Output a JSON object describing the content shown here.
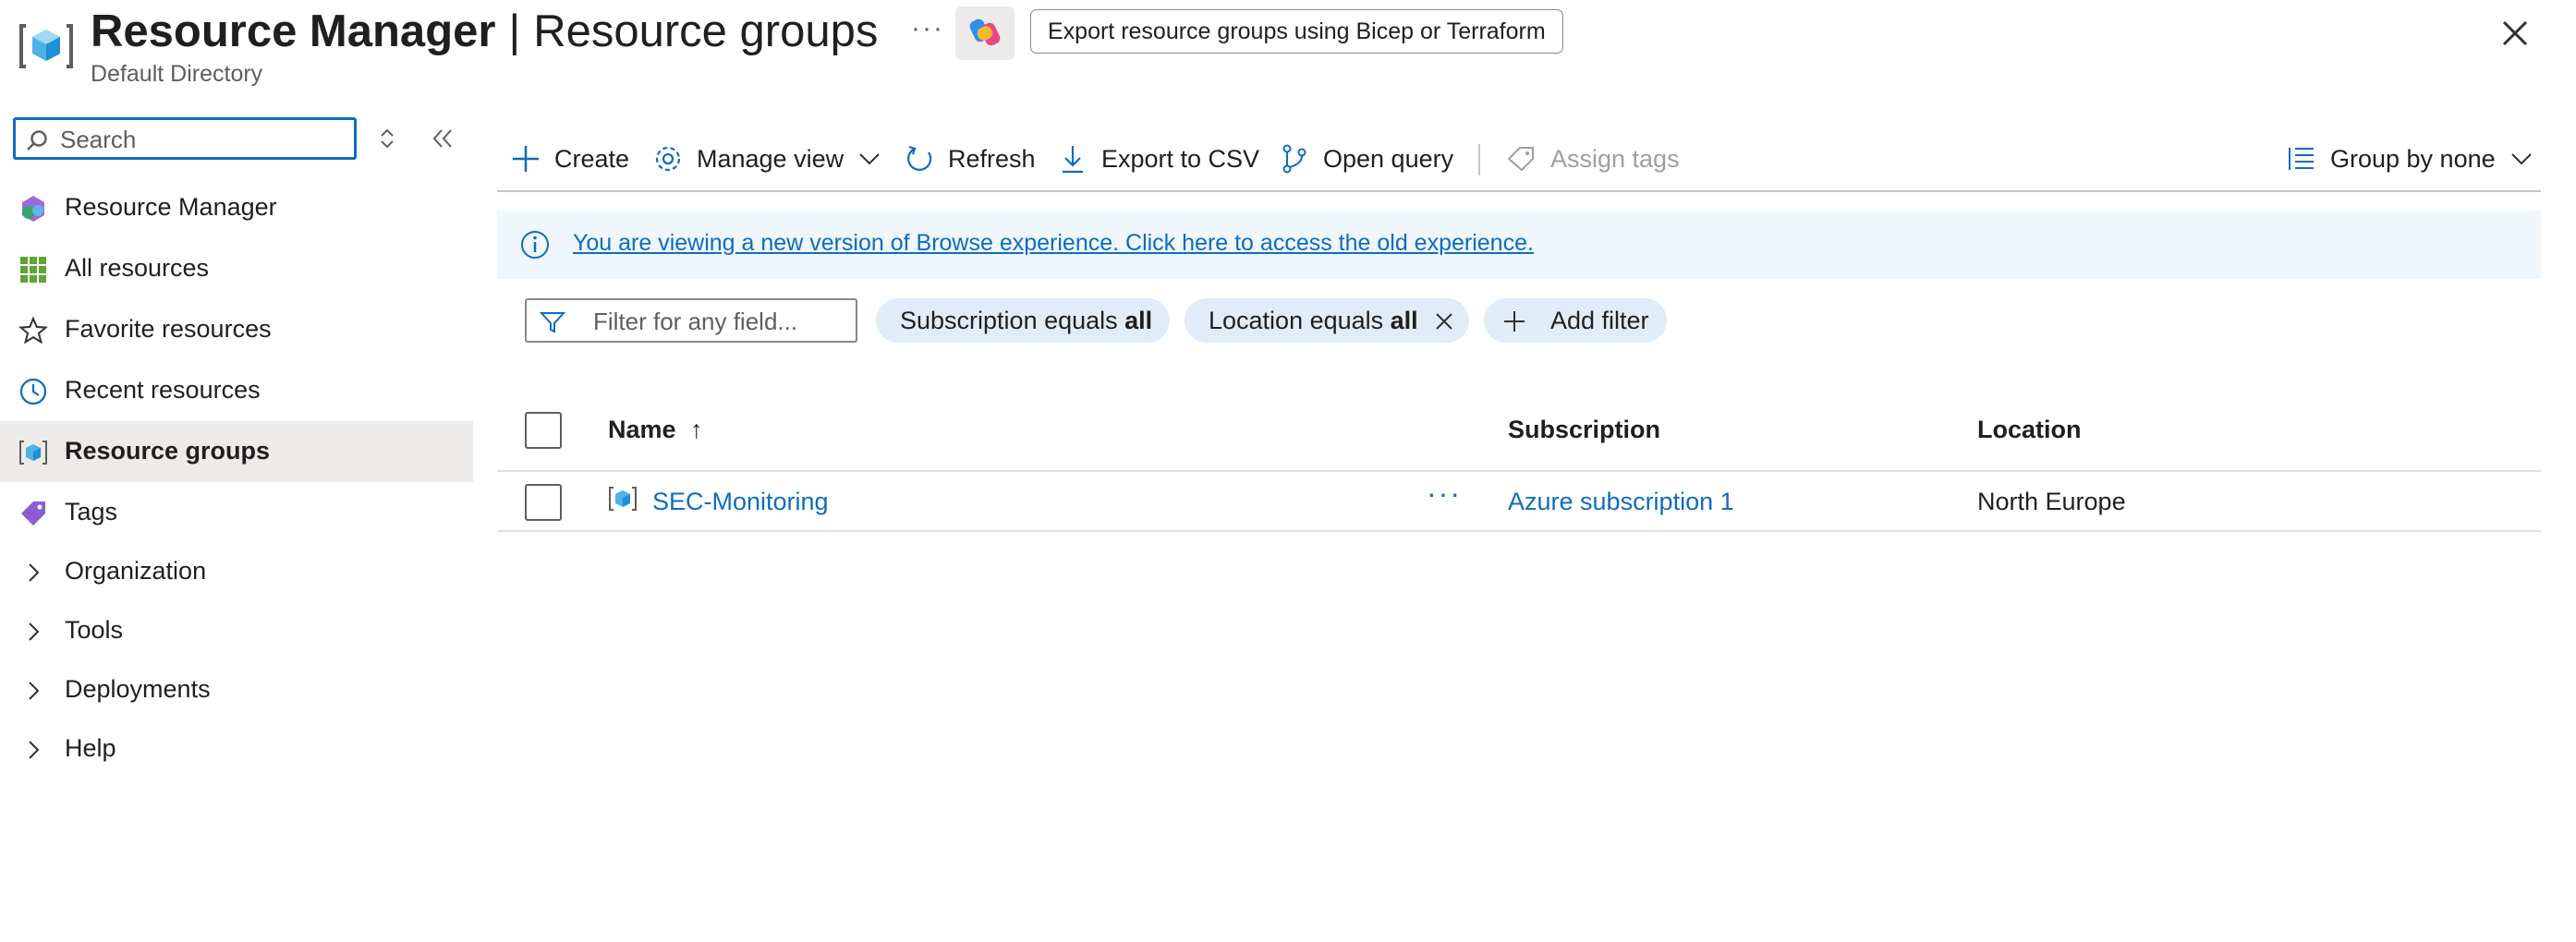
{
  "header": {
    "title_bold": "Resource Manager",
    "title_separator": "|",
    "title_rest": "Resource groups",
    "subtitle": "Default Directory",
    "more_label": "···",
    "export_button": "Export resource groups using Bicep or Terraform",
    "icon": "resource-group-icon"
  },
  "sidebar": {
    "search_placeholder": "Search",
    "items": [
      {
        "label": "Resource Manager",
        "icon": "resource-manager-icon"
      },
      {
        "label": "All resources",
        "icon": "grid-icon"
      },
      {
        "label": "Favorite resources",
        "icon": "star-icon"
      },
      {
        "label": "Recent resources",
        "icon": "clock-icon"
      },
      {
        "label": "Resource groups",
        "icon": "resource-group-icon",
        "active": true
      },
      {
        "label": "Tags",
        "icon": "tag-icon"
      },
      {
        "label": "Organization",
        "icon": "chevron-right-icon"
      },
      {
        "label": "Tools",
        "icon": "chevron-right-icon"
      },
      {
        "label": "Deployments",
        "icon": "chevron-right-icon"
      },
      {
        "label": "Help",
        "icon": "chevron-right-icon"
      }
    ]
  },
  "toolbar": {
    "create": "Create",
    "manage_view": "Manage view",
    "refresh": "Refresh",
    "export_csv": "Export to CSV",
    "open_query": "Open query",
    "assign_tags": "Assign tags",
    "group_by": "Group by none"
  },
  "banner": {
    "text": "You are viewing a new version of Browse experience. Click here to access the old experience."
  },
  "filters": {
    "input_placeholder": "Filter for any field...",
    "subscription_prefix": "Subscription equals ",
    "subscription_value": "all",
    "location_prefix": "Location equals ",
    "location_value": "all",
    "add_filter": "Add filter"
  },
  "table": {
    "columns": {
      "name": "Name",
      "sort_indicator": "↑",
      "subscription": "Subscription",
      "location": "Location"
    },
    "rows": [
      {
        "name": "SEC-Monitoring",
        "more": "···",
        "subscription": "Azure subscription 1",
        "location": "North Europe"
      }
    ]
  },
  "colors": {
    "accent": "#0f6cbd",
    "banner_bg": "#eff6fc",
    "pill_bg": "#e0ecf7",
    "active_nav_bg": "#edebe9"
  }
}
